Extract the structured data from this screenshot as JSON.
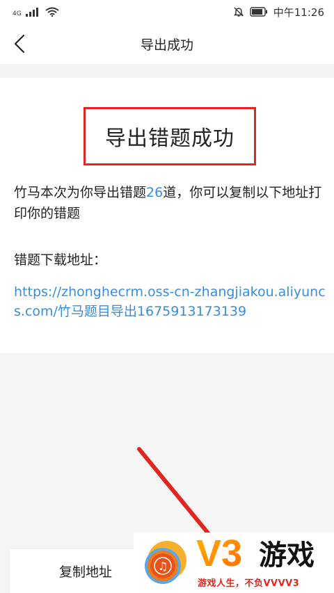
{
  "status_bar": {
    "network": "4G",
    "time": "中午11:26"
  },
  "nav": {
    "title": "导出成功"
  },
  "content": {
    "headline": "导出错题成功",
    "desc_prefix": "竹马本次为你导出错题",
    "count": "26",
    "desc_suffix": "道，你可以复制以下地址打印你的错题",
    "download_label": "错题下载地址：",
    "download_url": "https://zhonghecrm.oss-cn-zhangjiakou.aliyuncs.com/竹马题目导出1675913173139"
  },
  "actions": {
    "copy_label": "复制地址"
  },
  "watermark": {
    "brand": "V3游戏",
    "slogan": "游戏人生，不负VVVV3"
  },
  "colors": {
    "accent_blue": "#3a8dde",
    "annotation_red": "#e0261e",
    "background": "#f5f5f5"
  },
  "icons": {
    "back": "chevron-left-icon",
    "mute": "bell-off-icon",
    "battery": "battery-icon"
  }
}
